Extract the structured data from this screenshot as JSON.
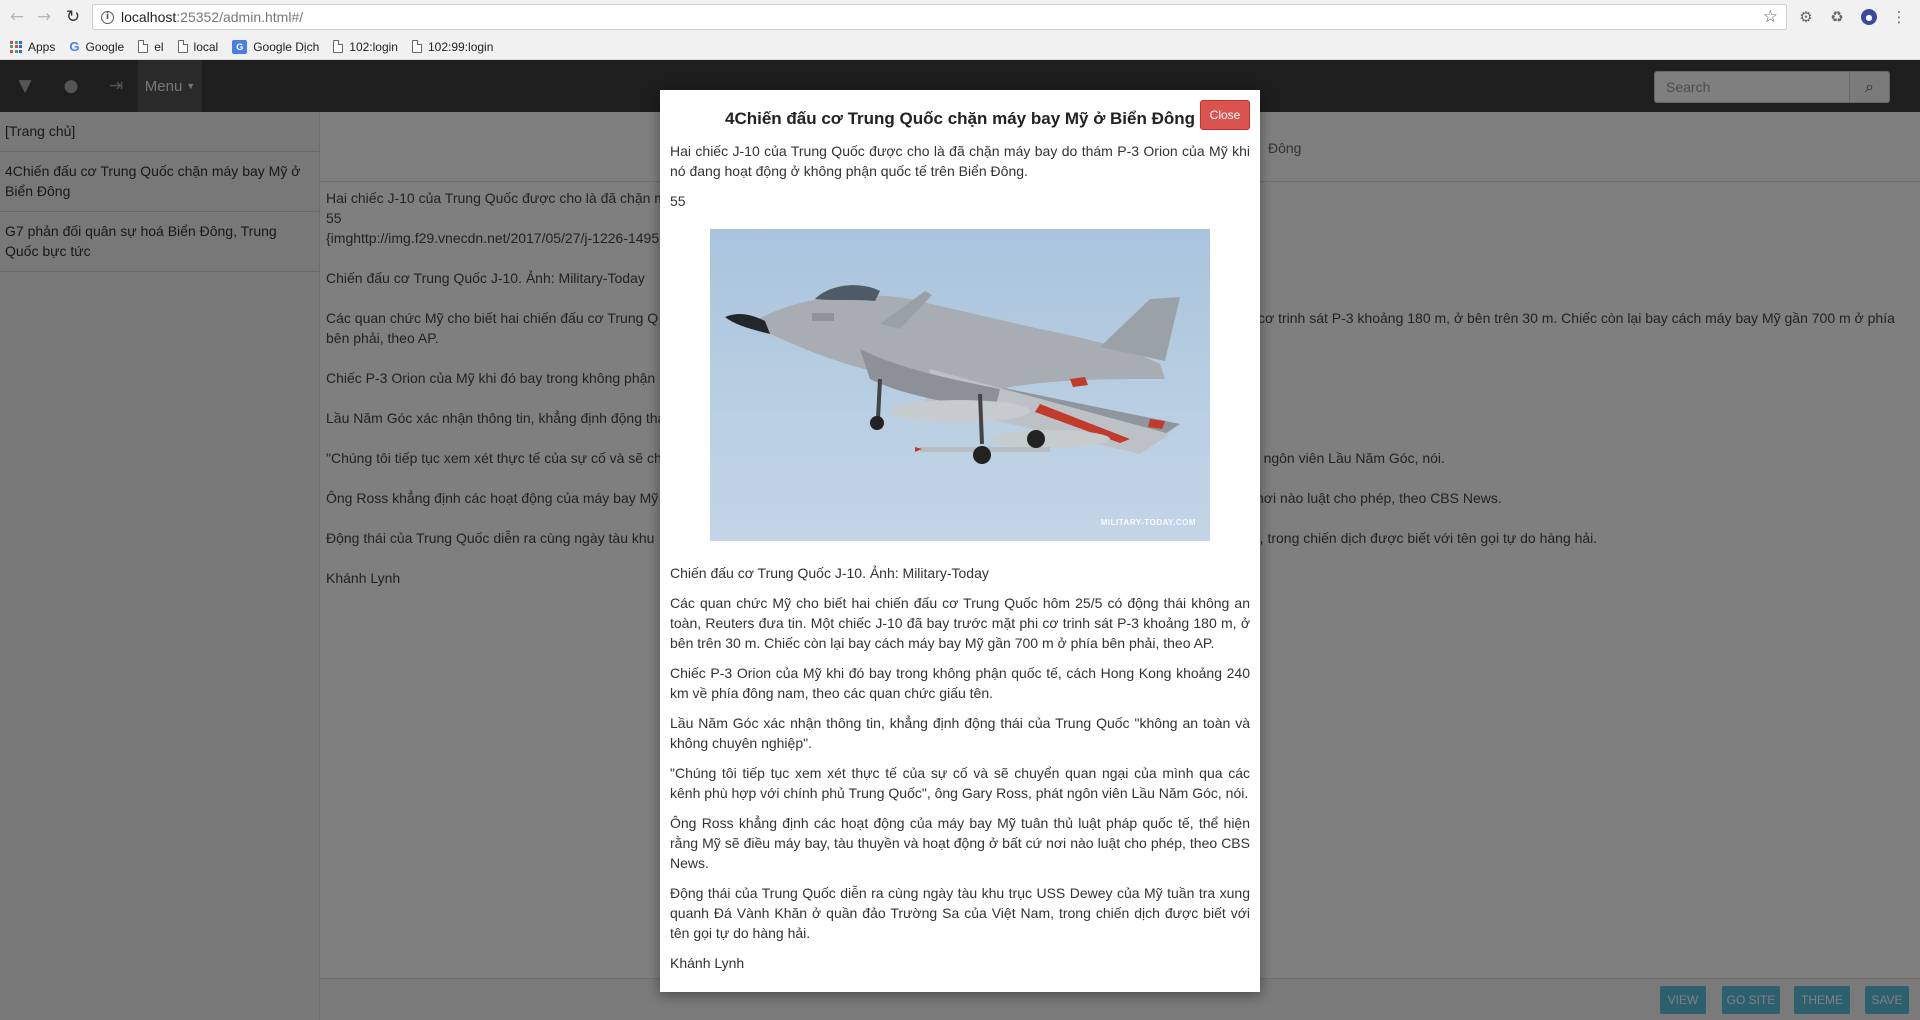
{
  "browser": {
    "url_host": "localhost",
    "url_rest": ":25352/admin.html#/",
    "bookmarks": [
      {
        "label": "Apps",
        "icon": "apps-grid-icon"
      },
      {
        "label": "Google",
        "icon": "google-icon"
      },
      {
        "label": "el",
        "icon": "page-icon"
      },
      {
        "label": "local",
        "icon": "page-icon"
      },
      {
        "label": "Google Dịch",
        "icon": "google-translate-icon"
      },
      {
        "label": "102:login",
        "icon": "page-icon"
      },
      {
        "label": "102:99:login",
        "icon": "page-icon"
      }
    ]
  },
  "topbar": {
    "menu_label": "Menu",
    "search_placeholder": "Search"
  },
  "sidebar": {
    "items": [
      {
        "label": "[Trang chủ]"
      },
      {
        "label": "4Chiến đấu cơ Trung Quốc chặn máy bay Mỹ ở Biển Đông"
      },
      {
        "label": "G7 phản đối quân sự hoá Biển Đông, Trung Quốc bực tức"
      }
    ]
  },
  "editor": {
    "head_title": "Đông",
    "lines": [
      {
        "left": "Hai chiếc J-10 của Trung Quốc được cho là đã chặn m",
        "right": ""
      },
      {
        "left": "55",
        "right": ""
      },
      {
        "left": "{imghttp://img.f29.vnecdn.net/2017/05/27/j-1226-1495",
        "right": ""
      },
      {
        "left": "Chiến đấu cơ Trung Quốc J-10. Ảnh: Military-Today",
        "right": ""
      },
      {
        "left": "Các quan chức Mỹ cho biết hai chiến đấu cơ Trung Q",
        "right": "cơ trinh sát P-3 khoảng 180 m, ở bên trên 30 m. Chiếc còn lại bay cách máy bay Mỹ gần 700 m ở phía"
      },
      {
        "left": "bên phải, theo AP.",
        "right": ""
      },
      {
        "left": "Chiếc P-3 Orion của Mỹ khi đó bay trong không phận",
        "right": ""
      },
      {
        "left": "Lầu Năm Góc xác nhận thông tin, khẳng định động thá",
        "right": ""
      },
      {
        "left": "\"Chúng tôi tiếp tục xem xét thực tế của sự cố và sẽ ch",
        "right": "át ngôn viên Lầu Năm Góc, nói."
      },
      {
        "left": "Ông Ross khẳng định các hoạt động của máy bay Mỹ",
        "right": "nơi nào luật cho phép, theo CBS News."
      },
      {
        "left": "Động thái của Trung Quốc diễn ra cùng ngày tàu khu",
        "right": "m, trong chiến dịch được biết với tên gọi tự do hàng hải."
      },
      {
        "left": "Khánh Lynh",
        "right": ""
      }
    ],
    "footer_buttons": [
      "VIEW",
      "GO SITE",
      "THEME",
      "SAVE"
    ]
  },
  "modal": {
    "title": "4Chiến đấu cơ Trung Quốc chặn máy bay Mỹ ở Biển Đông",
    "close_label": "Close",
    "intro": "Hai chiếc J-10 của Trung Quốc được cho là đã chặn máy bay do thám P-3 Orion của Mỹ khi nó đang hoạt động ở không phận quốc tế trên Biển Đông.",
    "number": "55",
    "image_credit": "MILITARY-TODAY.COM",
    "caption": "Chiến đấu cơ Trung Quốc J-10. Ảnh: Military-Today",
    "paragraphs": [
      "Các quan chức Mỹ cho biết hai chiến đấu cơ Trung Quốc hôm 25/5 có động thái không an toàn, Reuters đưa tin. Một chiếc J-10 đã bay trước mặt phi cơ trinh sát P-3 khoảng 180 m, ở bên trên 30 m. Chiếc còn lại bay cách máy bay Mỹ gần 700 m ở phía bên phải, theo AP.",
      "Chiếc P-3 Orion của Mỹ khi đó bay trong không phận quốc tế, cách Hong Kong khoảng 240 km về phía đông nam, theo các quan chức giấu tên.",
      "Lầu Năm Góc xác nhận thông tin, khẳng định động thái của Trung Quốc \"không an toàn và không chuyên nghiệp\".",
      "\"Chúng tôi tiếp tục xem xét thực tế của sự cố và sẽ chuyển quan ngại của mình qua các kênh phù hợp với chính phủ Trung Quốc\", ông Gary Ross, phát ngôn viên Lầu Năm Góc, nói.",
      "Ông Ross khẳng định các hoạt động của máy bay Mỹ tuân thủ luật pháp quốc tế, thể hiện rằng Mỹ sẽ điều máy bay, tàu thuyền và hoạt động ở bất cứ nơi nào luật cho phép, theo CBS News.",
      "Động thái của Trung Quốc diễn ra cùng ngày tàu khu trục USS Dewey của Mỹ tuần tra xung quanh Đá Vành Khăn ở quần đảo Trường Sa của Việt Nam, trong chiến dịch được biết với tên gọi tự do hàng hải."
    ],
    "author": "Khánh Lynh"
  }
}
